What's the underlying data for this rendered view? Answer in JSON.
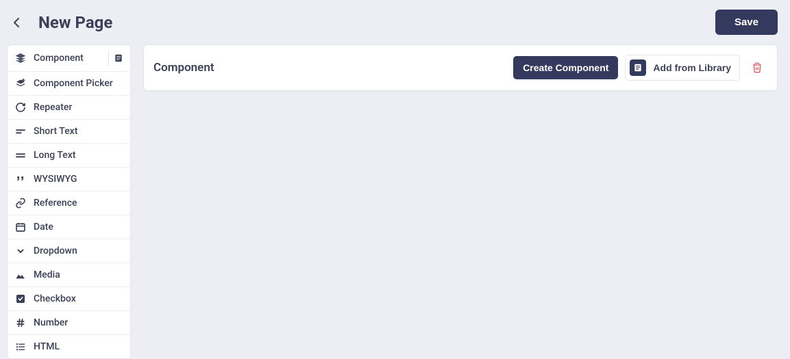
{
  "header": {
    "title": "New Page",
    "save_label": "Save"
  },
  "sidebar": {
    "items": [
      {
        "label": "Component",
        "icon": "layers-icon",
        "has_library": true
      },
      {
        "label": "Component Picker",
        "icon": "layers-pick-icon"
      },
      {
        "label": "Repeater",
        "icon": "repeat-icon"
      },
      {
        "label": "Short Text",
        "icon": "short-text-icon"
      },
      {
        "label": "Long Text",
        "icon": "long-text-icon"
      },
      {
        "label": "WYSIWYG",
        "icon": "quote-icon"
      },
      {
        "label": "Reference",
        "icon": "link-icon"
      },
      {
        "label": "Date",
        "icon": "calendar-icon"
      },
      {
        "label": "Dropdown",
        "icon": "chevron-down-icon"
      },
      {
        "label": "Media",
        "icon": "image-icon"
      },
      {
        "label": "Checkbox",
        "icon": "checkbox-icon"
      },
      {
        "label": "Number",
        "icon": "hash-icon"
      },
      {
        "label": "HTML",
        "icon": "list-icon"
      }
    ]
  },
  "main": {
    "component_title": "Component",
    "create_label": "Create Component",
    "library_label": "Add from Library"
  }
}
